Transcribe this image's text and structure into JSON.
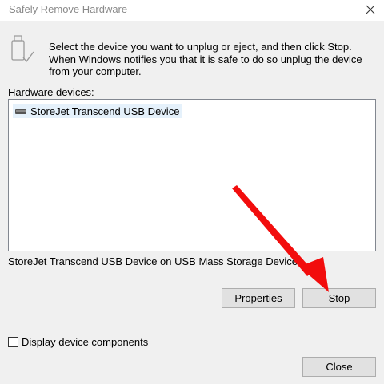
{
  "window": {
    "title": "Safely Remove Hardware",
    "close_icon": "close-x-icon"
  },
  "intro": {
    "icon": "usb-drive-icon",
    "text": "Select the device you want to unplug or eject, and then click Stop. When Windows notifies you that it is safe to do so unplug the device from your computer."
  },
  "hardware": {
    "label": "Hardware devices:",
    "items": [
      {
        "icon": "drive-icon",
        "label": "StoreJet Transcend USB Device",
        "selected": true
      }
    ],
    "description": "StoreJet Transcend USB Device on USB Mass Storage Device"
  },
  "buttons": {
    "properties": "Properties",
    "stop": "Stop",
    "close": "Close"
  },
  "options": {
    "display_components_label": "Display device components",
    "display_components_checked": false
  },
  "annotation": {
    "arrow_color": "#f20d0d"
  }
}
